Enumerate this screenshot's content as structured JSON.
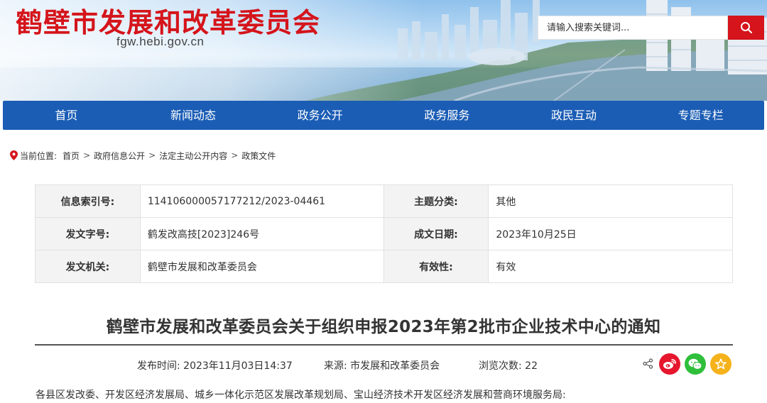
{
  "header": {
    "site_title": "鹤壁市发展和改革委员会",
    "site_domain": "fgw.hebi.gov.cn",
    "search_placeholder": "请输入搜索关键词..."
  },
  "nav": {
    "items": [
      "首页",
      "新闻动态",
      "政务公开",
      "政务服务",
      "政民互动",
      "专题专栏"
    ]
  },
  "breadcrumb": {
    "prefix": "当前位置:",
    "items": [
      "首页",
      "政府信息公开",
      "法定主动公开内容",
      "政策文件"
    ],
    "separator": ">"
  },
  "info": {
    "index_label": "信息索引号:",
    "index_value": "11410600005717721​2/2023-04461",
    "topic_label": "主题分类:",
    "topic_value": "其他",
    "docno_label": "发文字号:",
    "docno_value": "鹤发改高技[2023]246号",
    "date_label": "成文日期:",
    "date_value": "2023年10月25日",
    "issuer_label": "发文机关:",
    "issuer_value": "鹤壁市发展和改革委员会",
    "validity_label": "有效性:",
    "validity_value": "有效"
  },
  "article": {
    "title": "鹤壁市发展和改革委员会关于组织申报2023年第2批市企业技术中心的通知",
    "publish_time": "发布时间:  2023年11月03日14:37",
    "source": "来源:  市发展和改革委员会",
    "views": "浏览次数:  22",
    "first_line": "各县区发改委、开发区经济发展局、城乡一体化示范区发展改革规划局、宝山经济技术开发区经济发展和营商环境服务局:"
  },
  "colors": {
    "brand_red": "#d5141b",
    "nav_blue": "#1b5db5",
    "weibo_red": "#e6162d",
    "wechat_green": "#2fbf3b",
    "favorite_yellow": "#f5b21b"
  }
}
